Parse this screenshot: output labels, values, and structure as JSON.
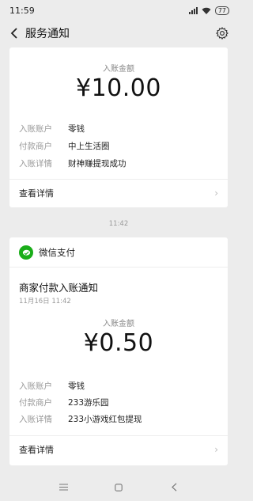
{
  "status_bar": {
    "time": "11:59",
    "battery": "77"
  },
  "header": {
    "title": "服务通知",
    "back_icon": "chevron-left-icon",
    "settings_icon": "gear-icon"
  },
  "notice1": {
    "amount_label": "入账金额",
    "amount": "¥10.00",
    "rows": [
      {
        "key": "入账账户",
        "value": "零钱"
      },
      {
        "key": "付款商户",
        "value": "中上生活圈"
      },
      {
        "key": "入账详情",
        "value": "财神赚提现成功"
      }
    ],
    "detail_label": "查看详情"
  },
  "time_separator": "11:42",
  "notice2": {
    "brand": "微信支付",
    "title": "商家付款入账通知",
    "time": "11月16日 11:42",
    "amount_label": "入账金额",
    "amount": "¥0.50",
    "rows": [
      {
        "key": "入账账户",
        "value": "零钱"
      },
      {
        "key": "付款商户",
        "value": "233游乐园"
      },
      {
        "key": "入账详情",
        "value": "233小游戏红包提现"
      }
    ],
    "detail_label": "查看详情"
  },
  "colors": {
    "wechat_green": "#1aad19",
    "background": "#ececec"
  }
}
